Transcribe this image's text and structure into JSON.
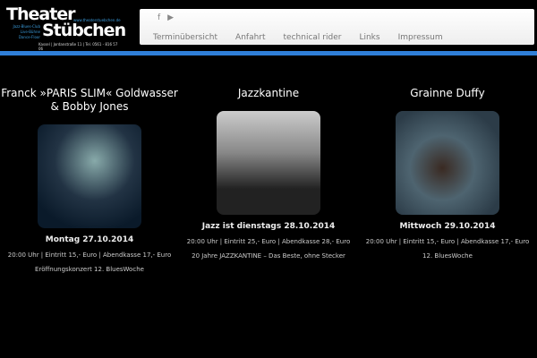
{
  "logo": {
    "line1": "Theater",
    "line2": "Stübchen",
    "url": "www.theaterstuebchen.de",
    "tags": [
      "Jazz-Blues-Club",
      "Live-Bühne",
      "Dance-Floor"
    ],
    "address": "Kassel | Jordanstraße 11 | Tel. 0561 - 816 57 06"
  },
  "social": {
    "facebook": "f",
    "youtube": "▶"
  },
  "menu": [
    "Terminübersicht",
    "Anfahrt",
    "technical rider",
    "Links",
    "Impressum"
  ],
  "accent": "#2f7fd8",
  "events": [
    {
      "title": "Franck »PARIS SLIM« Goldwasser & Bobby Jones",
      "date": "Montag 27.10.2014",
      "info1": "20:00 Uhr | Eintritt 15,- Euro | Abendkasse 17,- Euro",
      "info2": "Eröffnungskonzert 12. BluesWoche"
    },
    {
      "title": "Jazzkantine",
      "date": "Jazz ist dienstags 28.10.2014",
      "info1": "20:00 Uhr | Eintritt 25,- Euro | Abendkasse 28,- Euro",
      "info2": "20 Jahre JAZZKANTINE – Das Beste, ohne Stecker"
    },
    {
      "title": "Grainne Duffy",
      "date": "Mittwoch 29.10.2014",
      "info1": "20:00 Uhr | Eintritt 15,- Euro | Abendkasse 17,- Euro",
      "info2": "12. BluesWoche"
    }
  ]
}
